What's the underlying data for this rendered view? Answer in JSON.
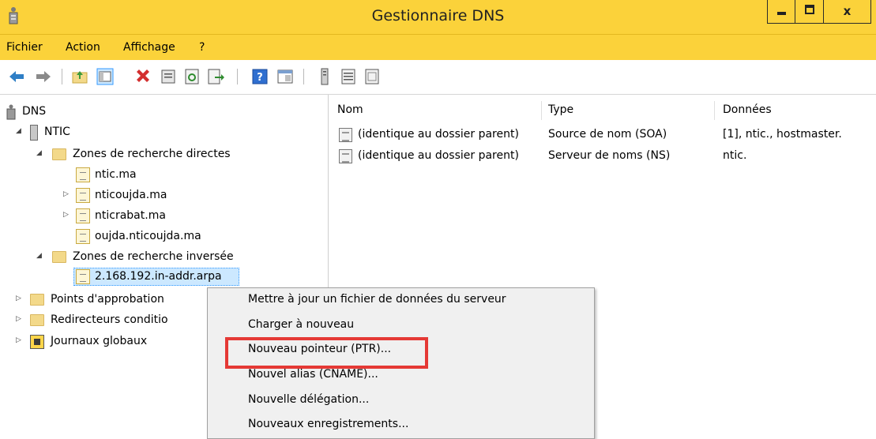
{
  "window": {
    "title": "Gestionnaire DNS",
    "close_glyph": "x"
  },
  "menu": {
    "items": [
      "Fichier",
      "Action",
      "Affichage",
      "?"
    ]
  },
  "toolbar": {
    "icons": [
      "back-arrow-icon",
      "forward-arrow-icon",
      "up-folder-icon",
      "show-hide-tree-icon",
      "delete-icon",
      "properties-icon",
      "refresh-icon",
      "export-list-icon",
      "help-icon",
      "console-icon",
      "server-icon",
      "list-icon",
      "record-icon"
    ]
  },
  "tree": {
    "root": "DNS",
    "server": "NTIC",
    "forward_zones": "Zones de recherche directes",
    "forward": [
      "ntic.ma",
      "nticoujda.ma",
      "nticrabat.ma",
      "oujda.nticoujda.ma"
    ],
    "reverse_zones": "Zones de recherche inversée",
    "reverse": [
      "2.168.192.in-addr.arpa"
    ],
    "trust_points": "Points d'approbation",
    "forwarders": "Redirecteurs conditio",
    "logs": "Journaux globaux"
  },
  "list": {
    "columns": [
      "Nom",
      "Type",
      "Données"
    ],
    "rows": [
      [
        "(identique au dossier parent)",
        "Source de nom (SOA)",
        "[1], ntic., hostmaster."
      ],
      [
        "(identique au dossier parent)",
        "Serveur de noms (NS)",
        "ntic."
      ]
    ]
  },
  "context_menu": {
    "items": [
      "Mettre à jour un fichier de données du serveur",
      "Charger à nouveau",
      "Nouveau pointeur (PTR)...",
      "Nouvel alias (CNAME)...",
      "Nouvelle délégation...",
      "Nouveaux enregistrements..."
    ]
  },
  "colors": {
    "titlebar": "#fbd23a",
    "highlight": "#e53935",
    "selection": "#cce8ff"
  }
}
